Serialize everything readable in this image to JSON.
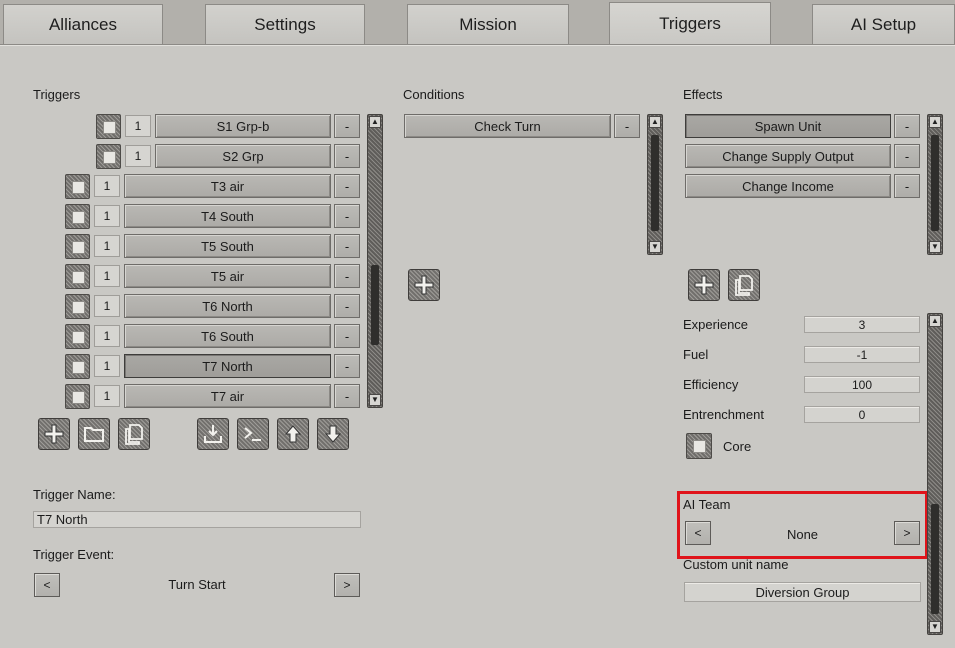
{
  "tabs": [
    {
      "label": "Alliances",
      "active": false
    },
    {
      "label": "Settings",
      "active": false
    },
    {
      "label": "Mission",
      "active": false
    },
    {
      "label": "Triggers",
      "active": true
    },
    {
      "label": "AI Setup",
      "active": false
    }
  ],
  "triggers": {
    "header": "Triggers",
    "rows": [
      {
        "num": "1",
        "name": "S1 Grp-b",
        "minus": "-",
        "selected": false
      },
      {
        "num": "1",
        "name": "S2 Grp",
        "minus": "-",
        "selected": false
      },
      {
        "num": "1",
        "name": "T3  air",
        "minus": "-",
        "selected": false
      },
      {
        "num": "1",
        "name": "T4 South",
        "minus": "-",
        "selected": false
      },
      {
        "num": "1",
        "name": "T5 South",
        "minus": "-",
        "selected": false
      },
      {
        "num": "1",
        "name": "T5  air",
        "minus": "-",
        "selected": false
      },
      {
        "num": "1",
        "name": "T6 North",
        "minus": "-",
        "selected": false
      },
      {
        "num": "1",
        "name": "T6 South",
        "minus": "-",
        "selected": false
      },
      {
        "num": "1",
        "name": "T7 North",
        "minus": "-",
        "selected": true
      },
      {
        "num": "1",
        "name": "T7  air",
        "minus": "-",
        "selected": false
      }
    ],
    "toolbar_icons": [
      "plus-icon",
      "folder-icon",
      "copy-icon",
      "import-icon",
      "console-icon",
      "arrow-up-icon",
      "arrow-down-icon"
    ]
  },
  "trigger_name": {
    "label": "Trigger Name:",
    "value": "T7 North"
  },
  "trigger_event": {
    "label": "Trigger Event:",
    "prev": "<",
    "value": "Turn Start",
    "next": ">"
  },
  "conditions": {
    "header": "Conditions",
    "items": [
      {
        "label": "Check Turn",
        "minus": "-"
      }
    ]
  },
  "effects": {
    "header": "Effects",
    "items": [
      {
        "label": "Spawn Unit",
        "minus": "-",
        "selected": true
      },
      {
        "label": "Change Supply Output",
        "minus": "-",
        "selected": false
      },
      {
        "label": "Change Income",
        "minus": "-",
        "selected": false
      }
    ]
  },
  "properties": {
    "experience": {
      "label": "Experience",
      "value": "3"
    },
    "fuel": {
      "label": "Fuel",
      "value": "-1"
    },
    "efficiency": {
      "label": "Efficiency",
      "value": "100"
    },
    "entrenchment": {
      "label": "Entrenchment",
      "value": "0"
    },
    "core": {
      "label": "Core"
    },
    "ai_team": {
      "label": "AI Team",
      "prev": "<",
      "value": "None",
      "next": ">"
    },
    "custom_name": {
      "label": "Custom unit name",
      "value": "Diversion Group"
    }
  },
  "colors": {
    "highlight": "#e0141b",
    "panel": "#c9c8c4"
  }
}
